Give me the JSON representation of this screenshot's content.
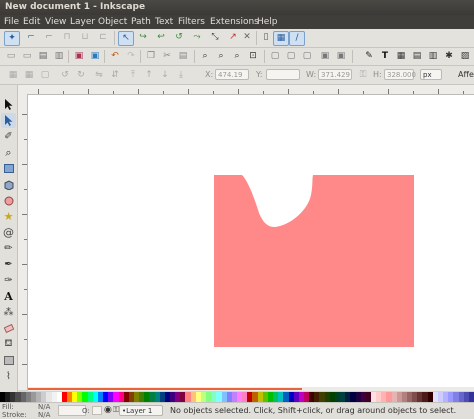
{
  "window": {
    "title": "New document 1 - Inkscape"
  },
  "menu": [
    "File",
    "Edit",
    "View",
    "Layer",
    "Object",
    "Path",
    "Text",
    "Filters",
    "Extensions",
    "Help"
  ],
  "controls": {
    "x_label": "X:",
    "x_value": "474.19",
    "y_label": "Y:",
    "y_value": "",
    "w_label": "W:",
    "w_value": "371.429",
    "h_label": "H:",
    "h_value": "328.000",
    "unit": "px",
    "affect_label": "Affe"
  },
  "status": {
    "fill_label": "Fill:",
    "fill_value": "N/A",
    "stroke_label": "Stroke:",
    "stroke_value": "N/A",
    "opacity_label": "O:",
    "layer": "•Layer 1",
    "message": "No objects selected. Click, Shift+click, or drag around objects to select."
  },
  "colors": {
    "shape_fill": "#ff8888",
    "selection_line": "#e8643a",
    "titlebar": "#3f3e3a",
    "palette": [
      "#000000",
      "#1a1a1a",
      "#333333",
      "#4d4d4d",
      "#666666",
      "#808080",
      "#999999",
      "#b3b3b3",
      "#cccccc",
      "#e6e6e6",
      "#f2f2f2",
      "#ffffff",
      "#ff0000",
      "#ff8000",
      "#ffff00",
      "#80ff00",
      "#00ff00",
      "#00ff80",
      "#00ffff",
      "#0080ff",
      "#0000ff",
      "#8000ff",
      "#ff00ff",
      "#ff0080",
      "#800000",
      "#804000",
      "#808000",
      "#408000",
      "#008000",
      "#008040",
      "#008080",
      "#004080",
      "#000080",
      "#400080",
      "#800080",
      "#800040",
      "#ff8080",
      "#ffc080",
      "#ffff80",
      "#c0ff80",
      "#80ff80",
      "#80ffc0",
      "#80ffff",
      "#80c0ff",
      "#8080ff",
      "#c080ff",
      "#ff80ff",
      "#ff80c0",
      "#c00000",
      "#c06000",
      "#c0c000",
      "#60c000",
      "#00c000",
      "#00c060",
      "#00c0c0",
      "#0060c0",
      "#0000c0",
      "#6000c0",
      "#c000c0",
      "#c00060",
      "#400000",
      "#402000",
      "#404000",
      "#204000",
      "#004000",
      "#004020",
      "#004040",
      "#002040",
      "#000040",
      "#200040",
      "#400040",
      "#400020",
      "#ffe0e0",
      "#ffcccc",
      "#ffb3b3",
      "#ff9999",
      "#e6b3b3",
      "#cc9999",
      "#b38080",
      "#996666",
      "#804d4d",
      "#663333",
      "#4d1a1a",
      "#330000",
      "#e0e0ff",
      "#ccccff",
      "#b3b3ff",
      "#9999ff",
      "#8080e6",
      "#6666cc",
      "#4d4db3",
      "#333399"
    ]
  }
}
